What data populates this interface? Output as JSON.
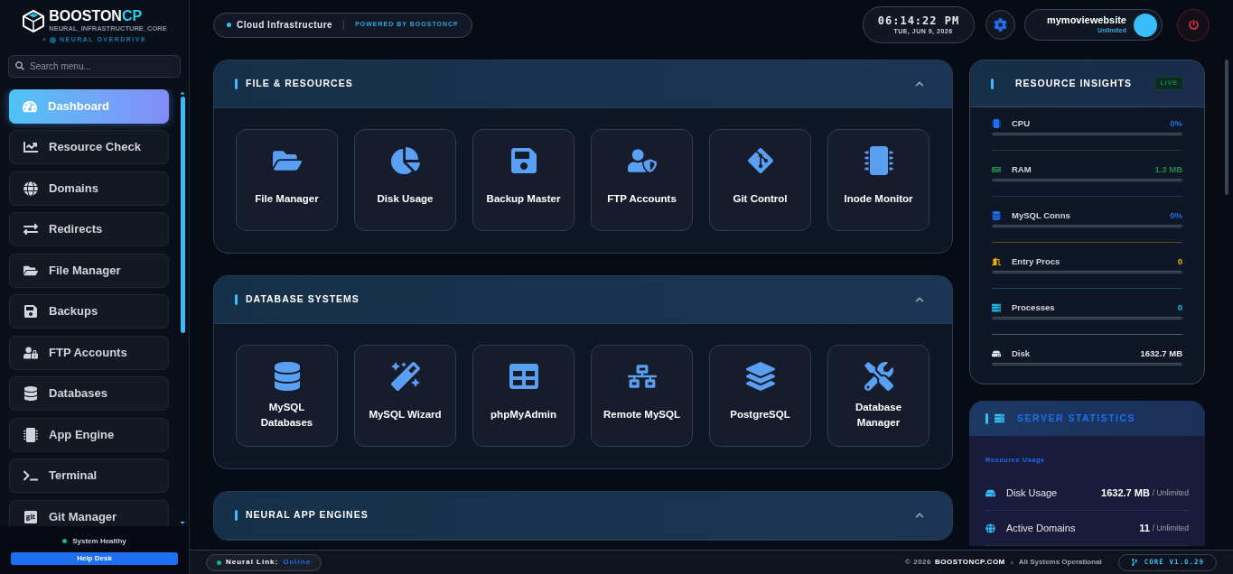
{
  "brand": {
    "name": "BOOSTON",
    "accent": "CP",
    "tagline": "NEURAL_INFRASTRUCTURE_CORE",
    "mode_prefix": ">",
    "mode": "NEURAL OVERDRIVE"
  },
  "search": {
    "placeholder": "Search menu..."
  },
  "sidebar": {
    "items": [
      {
        "label": "Dashboard",
        "selected": true
      },
      {
        "label": "Resource Check",
        "selected": false
      },
      {
        "label": "Domains",
        "selected": false
      },
      {
        "label": "Redirects",
        "selected": false
      },
      {
        "label": "File Manager",
        "selected": false
      },
      {
        "label": "Backups",
        "selected": false
      },
      {
        "label": "FTP Accounts",
        "selected": false
      },
      {
        "label": "Databases",
        "selected": false
      },
      {
        "label": "App Engine",
        "selected": false
      },
      {
        "label": "Terminal",
        "selected": false
      },
      {
        "label": "Git Manager",
        "selected": false
      }
    ],
    "status": "System Healthy",
    "help": "Help Desk"
  },
  "header": {
    "title": "Cloud Infrastructure",
    "powered": "POWERED BY BOOSTONCP",
    "time": "06:14:22 PM",
    "date": "TUE, JUN 9, 2026",
    "account": "mymoviewebsite",
    "plan": "Unlimited"
  },
  "sections": [
    {
      "title": "FILE & RESOURCES",
      "expanded": true,
      "tiles": [
        "File Manager",
        "Disk Usage",
        "Backup Master",
        "FTP Accounts",
        "Git Control",
        "Inode Monitor"
      ]
    },
    {
      "title": "DATABASE SYSTEMS",
      "expanded": true,
      "tiles": [
        "MySQL Databases",
        "MySQL Wizard",
        "phpMyAdmin",
        "Remote MySQL",
        "PostgreSQL",
        "Database Manager"
      ]
    },
    {
      "title": "NEURAL APP ENGINES",
      "expanded": true
    }
  ],
  "insights": {
    "title": "RESOURCE INSIGHTS",
    "badge": "LIVE",
    "metrics": [
      {
        "label": "CPU",
        "value": "0%",
        "level": 0,
        "color": "#1e6ef0"
      },
      {
        "label": "RAM",
        "value": "1.3 MB",
        "level": 0,
        "color": "#1f8a4c"
      },
      {
        "label": "MySQL Conns",
        "value": "0%",
        "level": 0,
        "color": "#1e6ef0"
      },
      {
        "label": "Entry Procs",
        "value": "0",
        "level": 0,
        "color": "#f0b400"
      },
      {
        "label": "Processes",
        "value": "0",
        "level": 0,
        "color": "#22b8e6"
      },
      {
        "label": "Disk",
        "value": "1632.7 MB",
        "level": 0,
        "color": "#e5e7eb"
      }
    ]
  },
  "stats": {
    "title": "SERVER STATISTICS",
    "subtitle": "Resource Usage",
    "rows": [
      {
        "label": "Disk Usage",
        "value": "1632.7 MB",
        "limit": "/ Unlimited"
      },
      {
        "label": "Active Domains",
        "value": "11",
        "limit": "/ Unlimited"
      }
    ]
  },
  "footer": {
    "link_label": "Neural Link:",
    "link_state": "Online",
    "copyright": "© 2026",
    "site": "BOOSTONCP.COM",
    "status": "All Systems Operational",
    "version": "CORE V1.0.29"
  }
}
